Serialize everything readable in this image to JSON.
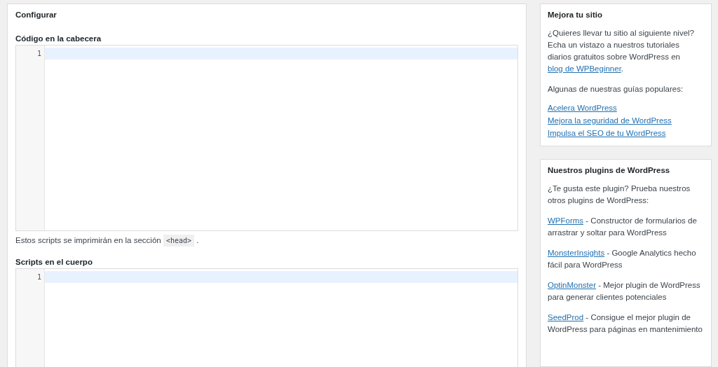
{
  "main": {
    "title": "Configurar",
    "editors": [
      {
        "label": "Código en la cabecera",
        "line_numbers": [
          "1"
        ],
        "note": {
          "before": "Estos scripts se imprimirán en la sección",
          "code": "<head>",
          "after": "."
        }
      },
      {
        "label": "Scripts en el cuerpo",
        "line_numbers": [
          "1"
        ]
      }
    ]
  },
  "sidebar": [
    {
      "kind": "guides",
      "title": "Mejora tu sitio",
      "intro": {
        "before": "¿Quieres llevar tu sitio al siguiente nivel? Echa un vistazo a nuestros tutoriales diarios gratuitos sobre WordPress en",
        "link": "blog de WPBeginner",
        "after": "."
      },
      "subtitle": "Algunas de nuestras guías populares:",
      "links": [
        "Acelera WordPress",
        "Mejora la seguridad de WordPress",
        "Impulsa el SEO de tu WordPress"
      ]
    },
    {
      "kind": "plugins",
      "title": "Nuestros plugins de WordPress",
      "intro": {
        "before": "¿Te gusta este plugin? Prueba nuestros otros plugins de WordPress:"
      },
      "plugins": [
        {
          "name": "WPForms",
          "description": "- Constructor de formularios de arrastrar y soltar para WordPress"
        },
        {
          "name": "MonsterInsights",
          "description": "- Google Analytics hecho fácil para WordPress"
        },
        {
          "name": "OptinMonster",
          "description": "- Mejor plugin de WordPress para generar clientes potenciales"
        },
        {
          "name": "SeedProd",
          "description": "- Consigue el mejor plugin de WordPress para páginas en mantenimiento"
        }
      ]
    }
  ]
}
